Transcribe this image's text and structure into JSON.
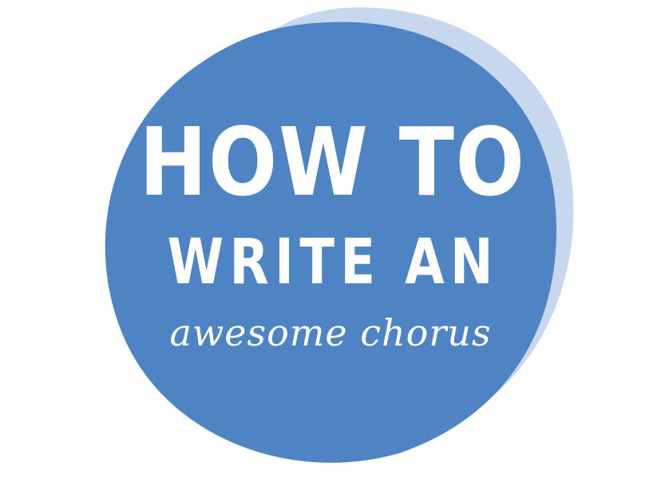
{
  "title": {
    "line1": "HOW TO",
    "line2": "WRITE AN",
    "line3": "awesome chorus"
  },
  "colors": {
    "background": "#ffffff",
    "circle": "#4f84c4",
    "shadow": "#c7d7ee",
    "text": "#ffffff"
  }
}
